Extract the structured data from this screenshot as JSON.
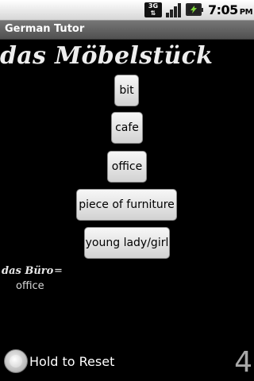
{
  "status_bar": {
    "network_label": "3G",
    "time": "7:05",
    "ampm": "PM",
    "icons": [
      "network-3g-icon",
      "signal-icon",
      "battery-charging-icon"
    ]
  },
  "app": {
    "title": "German Tutor"
  },
  "quiz": {
    "word": "das Möbelstück",
    "choices": [
      "bit",
      "cafe",
      "office",
      "piece of furniture",
      "young lady/girl"
    ]
  },
  "previous": {
    "word": "das Büro",
    "equals": "=",
    "translation": "office"
  },
  "footer": {
    "reset_label": "Hold to Reset",
    "score": "4"
  },
  "colors": {
    "background": "#000000",
    "button_top": "#f7f7f7",
    "button_bottom": "#d2d2d2",
    "score": "#a8a8a8"
  }
}
